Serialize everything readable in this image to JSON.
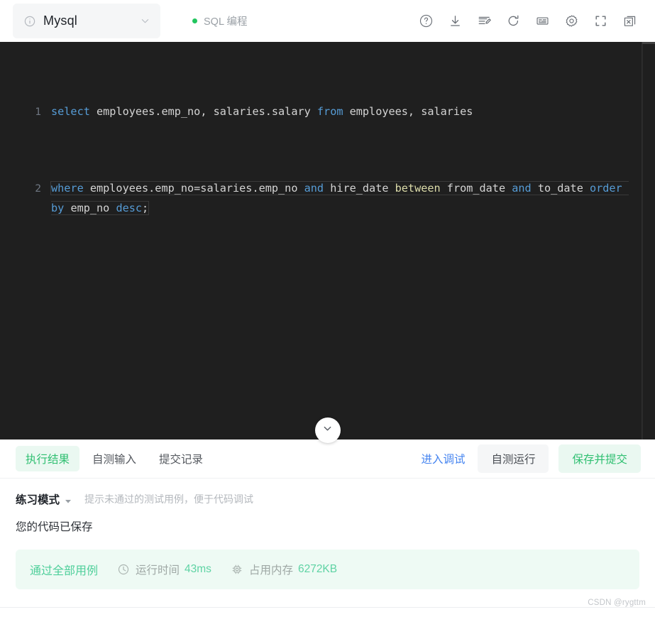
{
  "topbar": {
    "language_selector": {
      "icon": "info-circle-icon",
      "value": "Mysql",
      "caret": "chevron-down-icon"
    },
    "mode_badge": {
      "dot_color": "#22c55e",
      "label": "SQL 编程"
    },
    "tool_icons": [
      {
        "name": "help-icon",
        "title": "帮助"
      },
      {
        "name": "download-icon",
        "title": "下载"
      },
      {
        "name": "format-code-icon",
        "title": "格式化"
      },
      {
        "name": "refresh-icon",
        "title": "重置"
      },
      {
        "name": "keyboard-icon",
        "title": "快捷键"
      },
      {
        "name": "settings-gear-icon",
        "title": "设置"
      },
      {
        "name": "fullscreen-icon",
        "title": "全屏"
      },
      {
        "name": "close-window-icon",
        "title": "关闭"
      }
    ]
  },
  "editor": {
    "theme": "dark",
    "background": "#1f1f1f",
    "lines": [
      {
        "number": "1"
      },
      {
        "number": "2"
      }
    ],
    "code_plain": "select employees.emp_no, salaries.salary from employees, salaries\nwhere employees.emp_no=salaries.emp_no and hire_date between from_date and to_date order by emp_no desc;",
    "tokens_line1": [
      {
        "t": "select",
        "c": "kw"
      },
      {
        "t": " employees.emp_no, salaries.salary ",
        "c": "id"
      },
      {
        "t": "from",
        "c": "kw"
      },
      {
        "t": " employees, salaries",
        "c": "id"
      }
    ],
    "tokens_line2": [
      {
        "t": "where",
        "c": "kw"
      },
      {
        "t": " employees.emp_no=salaries.emp_no ",
        "c": "id"
      },
      {
        "t": "and",
        "c": "kw"
      },
      {
        "t": " hire_date ",
        "c": "id"
      },
      {
        "t": "between",
        "c": "fn"
      },
      {
        "t": " from_date ",
        "c": "id"
      },
      {
        "t": "and",
        "c": "kw"
      },
      {
        "t": " to_date ",
        "c": "id"
      },
      {
        "t": "order",
        "c": "kw"
      },
      {
        "t": " ",
        "c": "id"
      },
      {
        "t": "by",
        "c": "kw"
      },
      {
        "t": " emp_no ",
        "c": "id"
      },
      {
        "t": "desc",
        "c": "kw"
      },
      {
        "t": ";",
        "c": "pun"
      }
    ],
    "colors": {
      "keyword": "#569cd6",
      "function": "#dcdcaa",
      "identifier": "#d4d4d4",
      "gutter": "#6e7681"
    }
  },
  "collapse_handle": {
    "icon": "chevron-down-icon"
  },
  "panel": {
    "tabs": [
      {
        "label": "执行结果",
        "active": true
      },
      {
        "label": "自测输入",
        "active": false
      },
      {
        "label": "提交记录",
        "active": false
      }
    ],
    "actions": {
      "debug_label": "进入调试",
      "self_run_label": "自测运行",
      "submit_label": "保存并提交"
    },
    "practice_mode": {
      "name": "练习模式",
      "caret": "caret-down-icon",
      "hint": "提示未通过的测试用例，便于代码调试"
    },
    "saved_message": "您的代码已保存",
    "result": {
      "status": "通过全部用例",
      "metrics": [
        {
          "icon": "clock-icon",
          "label": "运行时间",
          "value": "43ms"
        },
        {
          "icon": "memory-chip-icon",
          "label": "占用内存",
          "value": "6272KB"
        }
      ],
      "accent": "#4ecf9a",
      "background": "#eefaf4"
    }
  },
  "watermark": "CSDN @rygttm"
}
